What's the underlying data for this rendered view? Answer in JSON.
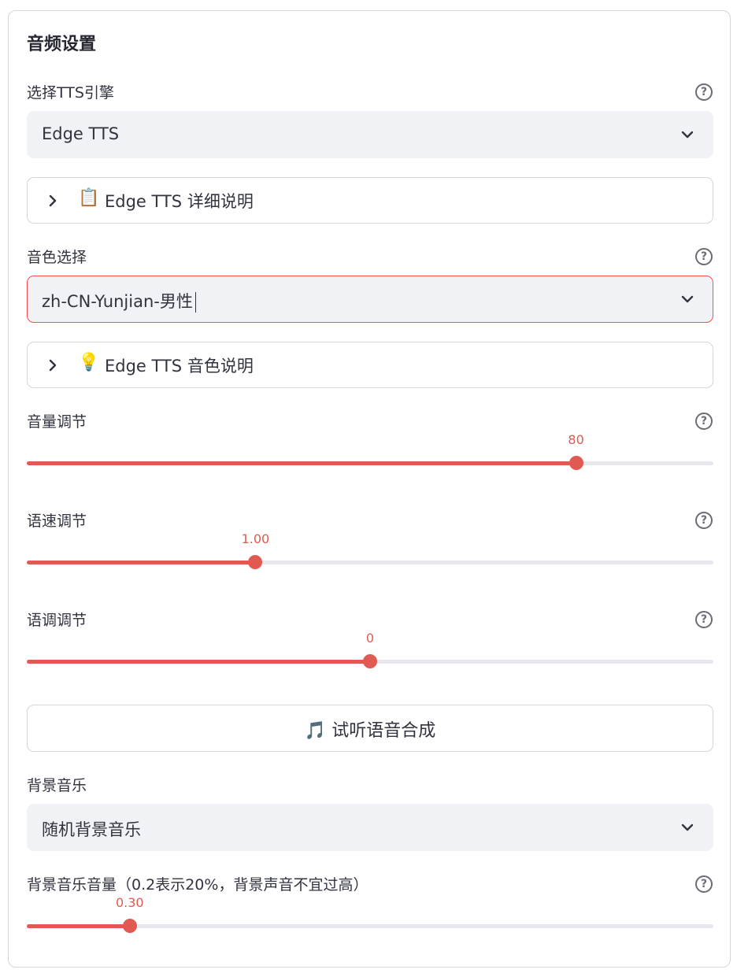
{
  "section_title": "音频设置",
  "tts_engine": {
    "label": "选择TTS引擎",
    "value": "Edge TTS"
  },
  "expander_details": {
    "icon": "📋",
    "label": "Edge TTS 详细说明"
  },
  "voice": {
    "label": "音色选择",
    "value": "zh-CN-Yunjian-男性"
  },
  "expander_voice": {
    "icon": "💡",
    "label": "Edge TTS 音色说明"
  },
  "volume": {
    "label": "音量调节",
    "display": "80",
    "fraction": 0.8
  },
  "speed": {
    "label": "语速调节",
    "display": "1.00",
    "fraction": 0.333
  },
  "pitch": {
    "label": "语调调节",
    "display": "0",
    "fraction": 0.5
  },
  "preview_button": {
    "icon": "🎵",
    "label": "试听语音合成"
  },
  "bgm": {
    "label": "背景音乐",
    "value": "随机背景音乐"
  },
  "bgm_volume": {
    "label": "背景音乐音量（0.2表示20%，背景声音不宜过高）",
    "display": "0.30",
    "fraction": 0.15
  },
  "help_glyph": "?",
  "colors": {
    "accent": "#e05a52",
    "select_bg": "#f0f2f6",
    "track": "#e6e8ee",
    "focus_border": "#ff4b4b"
  }
}
